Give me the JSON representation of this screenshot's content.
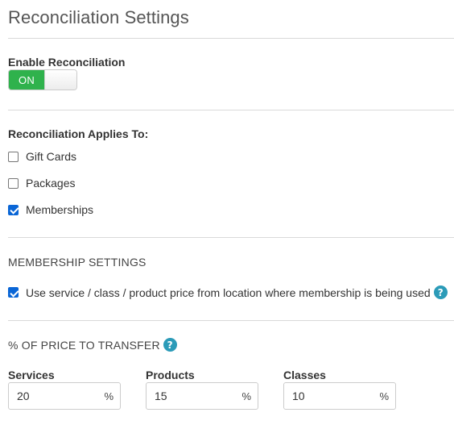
{
  "title": "Reconciliation Settings",
  "enable": {
    "label": "Enable Reconciliation",
    "toggle_text": "ON",
    "toggle_state": true,
    "on_color": "#2fb24c"
  },
  "applies_to": {
    "label": "Reconciliation Applies To:",
    "options": [
      {
        "label": "Gift Cards",
        "checked": false
      },
      {
        "label": "Packages",
        "checked": false
      },
      {
        "label": "Memberships",
        "checked": true
      }
    ]
  },
  "membership": {
    "heading": "MEMBERSHIP SETTINGS",
    "option": {
      "label": "Use service / class / product price from location where membership is being used",
      "checked": true
    },
    "help_icon": "question-circle-icon"
  },
  "transfer": {
    "heading": "% OF PRICE TO TRANSFER",
    "help_icon": "question-circle-icon",
    "fields": [
      {
        "label": "Services",
        "value": "20",
        "suffix": "%"
      },
      {
        "label": "Products",
        "value": "15",
        "suffix": "%"
      },
      {
        "label": "Classes",
        "value": "10",
        "suffix": "%"
      }
    ]
  },
  "colors": {
    "help": "#2b9bb8",
    "checkbox": "#0a66d6"
  }
}
